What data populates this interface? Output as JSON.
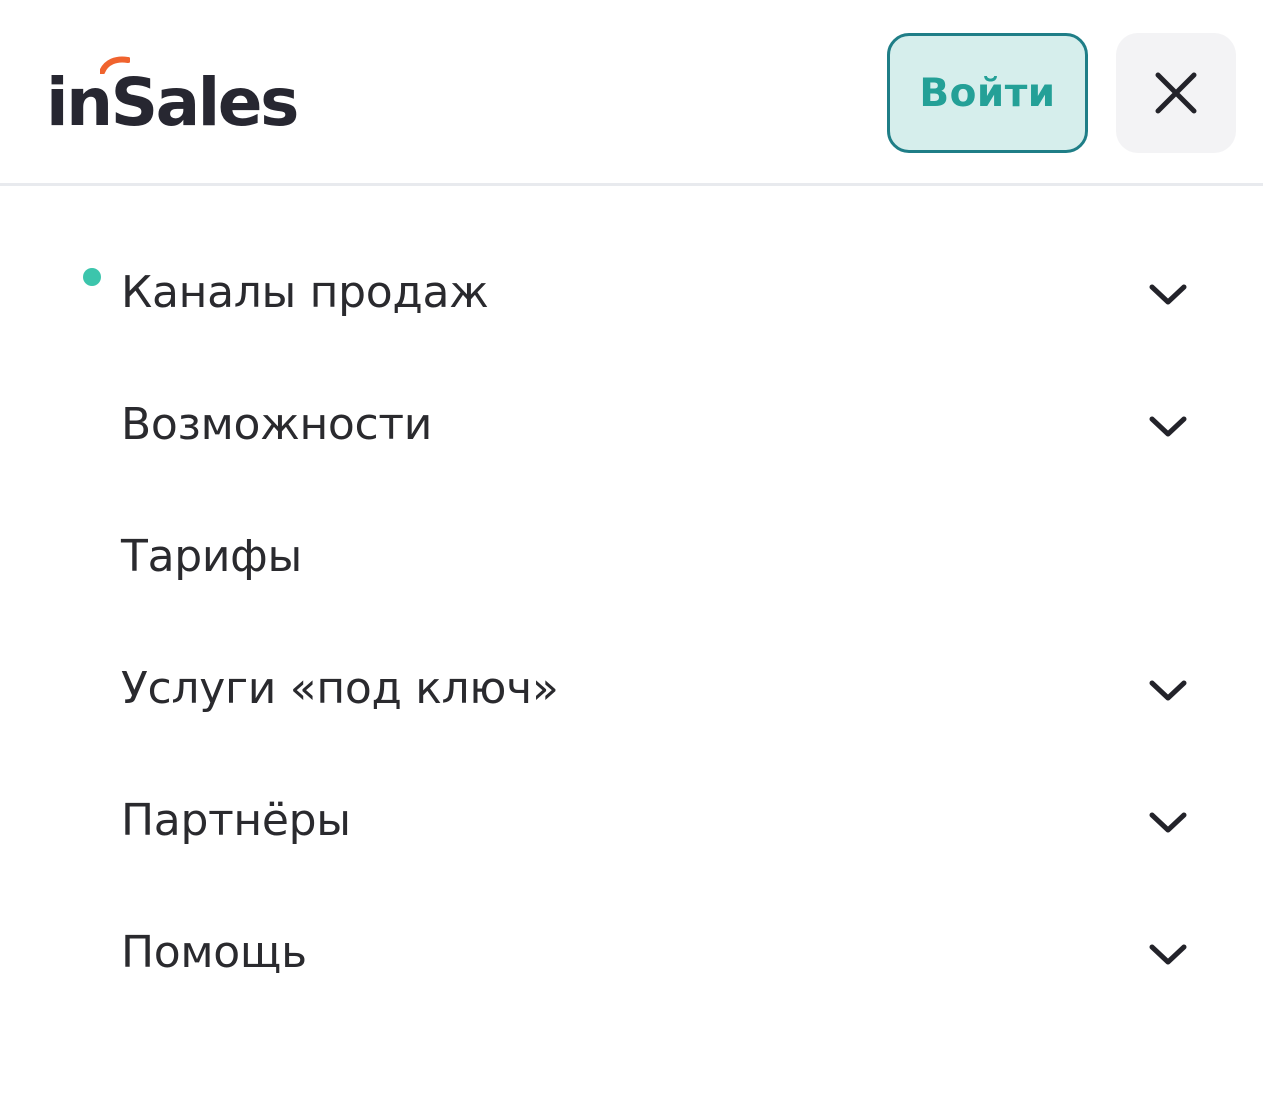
{
  "header": {
    "logo_text": "inSales",
    "login_label": "Войти",
    "close_icon": "close-icon",
    "colors": {
      "logo_accent": "#f0632e",
      "login_bg": "#d6eeec",
      "login_border": "#1f7e87",
      "login_text": "#24a097"
    }
  },
  "menu": {
    "active_dot_color": "#3cc5ac",
    "items": [
      {
        "label": "Каналы продаж",
        "has_submenu": true,
        "active": true,
        "icon": "chevron-down-icon"
      },
      {
        "label": "Возможности",
        "has_submenu": true,
        "active": false,
        "icon": "chevron-down-icon"
      },
      {
        "label": "Тарифы",
        "has_submenu": false,
        "active": false
      },
      {
        "label": "Услуги «под ключ»",
        "has_submenu": true,
        "active": false,
        "icon": "chevron-down-icon"
      },
      {
        "label": "Партнёры",
        "has_submenu": true,
        "active": false,
        "icon": "chevron-down-icon"
      },
      {
        "label": "Помощь",
        "has_submenu": true,
        "active": false,
        "icon": "chevron-down-icon"
      }
    ]
  }
}
